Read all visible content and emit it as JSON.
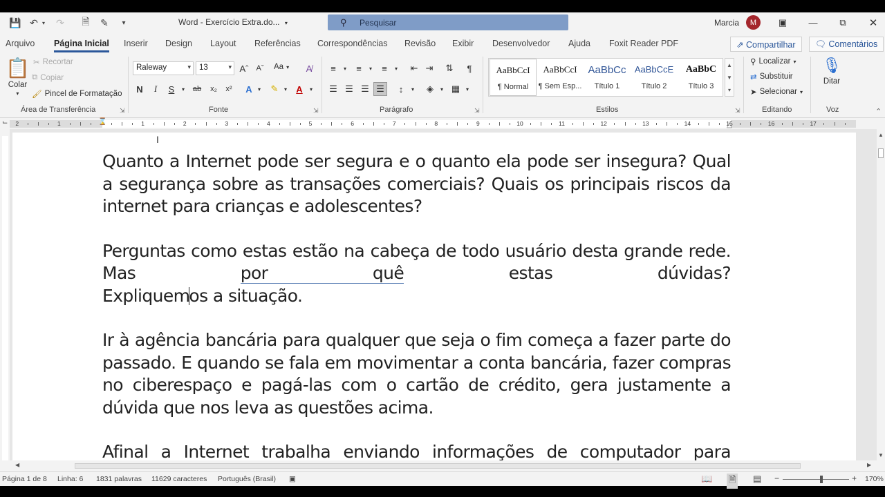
{
  "title_bar": {
    "doc_title": "Word - Exercício Extra.do...",
    "search_placeholder": "Pesquisar",
    "user_name": "Marcia",
    "avatar_initial": "M"
  },
  "tabs": [
    "Arquivo",
    "Página Inicial",
    "Inserir",
    "Design",
    "Layout",
    "Referências",
    "Correspondências",
    "Revisão",
    "Exibir",
    "Desenvolvedor",
    "Ajuda",
    "Foxit Reader PDF"
  ],
  "tab_actions": {
    "share": "Compartilhar",
    "comments": "Comentários"
  },
  "ribbon": {
    "clipboard": {
      "paste": "Colar",
      "cut": "Recortar",
      "copy": "Copiar",
      "format_painter": "Pincel de Formatação",
      "label": "Área de Transferência"
    },
    "font": {
      "font_name": "Raleway",
      "font_size": "13",
      "case_label": "Aa",
      "bold": "N",
      "italic": "I",
      "underline": "S",
      "strike": "ab",
      "subscript": "x₂",
      "superscript": "x²",
      "label": "Fonte"
    },
    "paragraph": {
      "label": "Parágrafo"
    },
    "styles": {
      "items": [
        {
          "sample": "AaBbCcI",
          "name": "¶ Normal"
        },
        {
          "sample": "AaBbCcI",
          "name": "¶ Sem Esp..."
        },
        {
          "sample": "AaBbCc",
          "name": "Título 1"
        },
        {
          "sample": "AaBbCcE",
          "name": "Título 2"
        },
        {
          "sample": "AaBbC",
          "name": "Título 3"
        }
      ],
      "label": "Estilos"
    },
    "editing": {
      "find": "Localizar",
      "replace": "Substituir",
      "select": "Selecionar",
      "label": "Editando"
    },
    "voice": {
      "dictate": "Ditar",
      "label": "Voz"
    }
  },
  "ruler": {
    "numbers": [
      "2",
      "1",
      "1",
      "2",
      "3",
      "4",
      "5",
      "6",
      "7",
      "8",
      "9",
      "10",
      "11",
      "12",
      "13",
      "14",
      "15",
      "16",
      "17"
    ]
  },
  "document": {
    "p1": "Quanto a Internet pode ser segura e o quanto ela pode ser insegura? Qual a segurança sobre as transações comerciais? Quais os principais riscos da internet para crianças e adolescentes?",
    "p2_a": "Perguntas como estas estão na cabeça de todo usuário desta grande rede. Mas ",
    "p2_ul": "por quê",
    "p2_b": " estas dúvidas?",
    "p2_c1": "Expliquem",
    "p2_c2": "os a situação.",
    "p3": "Ir à agência bancária para qualquer que seja o fim começa a fazer parte do passado. E quando se fala em movimentar a conta bancária, fazer compras no ciberespaço e pagá-las com o cartão de crédito, gera justamente a dúvida que nos leva as questões acima.",
    "p4": "Afinal a Internet trabalha enviando informações de computador para"
  },
  "status_bar": {
    "page": "Página 1 de 8",
    "line": "Linha: 6",
    "words": "1831 palavras",
    "chars": "11629 caracteres",
    "language": "Português (Brasil)",
    "zoom": "170%",
    "zoom_level": 1.7
  },
  "colors": {
    "accent": "#2b579a",
    "avatar": "#a4262c",
    "search": "#7f9cc7"
  }
}
